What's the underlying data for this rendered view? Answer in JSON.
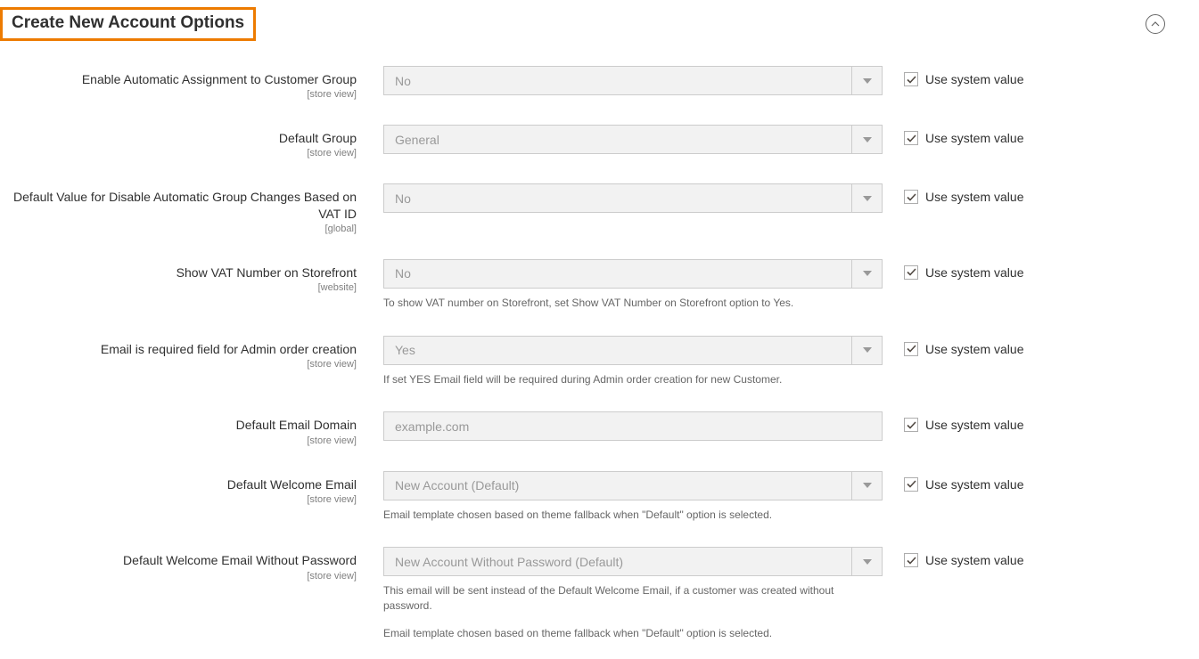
{
  "section_title": "Create New Account Options",
  "use_system_value_label": "Use system value",
  "fields": [
    {
      "label": "Enable Automatic Assignment to Customer Group",
      "scope": "[store view]",
      "type": "select",
      "value": "No",
      "note": "",
      "use_system": true
    },
    {
      "label": "Default Group",
      "scope": "[store view]",
      "type": "select",
      "value": "General",
      "note": "",
      "use_system": true
    },
    {
      "label": "Default Value for Disable Automatic Group Changes Based on VAT ID",
      "scope": "[global]",
      "type": "select",
      "value": "No",
      "note": "",
      "use_system": true
    },
    {
      "label": "Show VAT Number on Storefront",
      "scope": "[website]",
      "type": "select",
      "value": "No",
      "note": "To show VAT number on Storefront, set Show VAT Number on Storefront option to Yes.",
      "use_system": true
    },
    {
      "label": "Email is required field for Admin order creation",
      "scope": "[store view]",
      "type": "select",
      "value": "Yes",
      "note": "If set YES Email field will be required during Admin order creation for new Customer.",
      "use_system": true
    },
    {
      "label": "Default Email Domain",
      "scope": "[store view]",
      "type": "text",
      "value": "example.com",
      "note": "",
      "use_system": true
    },
    {
      "label": "Default Welcome Email",
      "scope": "[store view]",
      "type": "select",
      "value": "New Account (Default)",
      "note": "Email template chosen based on theme fallback when \"Default\" option is selected.",
      "use_system": true
    },
    {
      "label": "Default Welcome Email Without Password",
      "scope": "[store view]",
      "type": "select",
      "value": "New Account Without Password (Default)",
      "note": "This email will be sent instead of the Default Welcome Email, if a customer was created without password.",
      "note2": "Email template chosen based on theme fallback when \"Default\" option is selected.",
      "use_system": true
    }
  ]
}
